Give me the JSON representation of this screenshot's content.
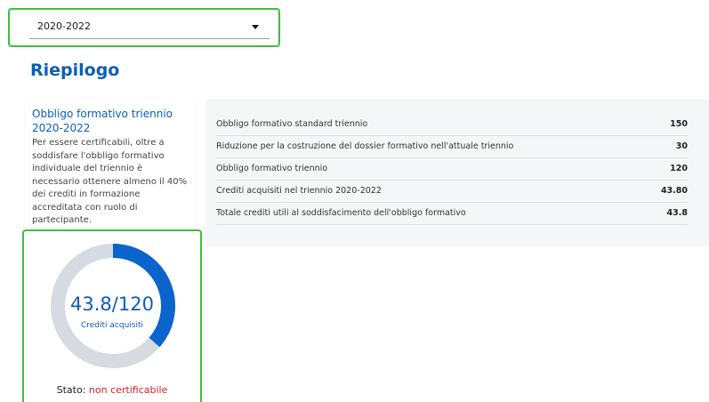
{
  "selector": {
    "value": "2020-2022"
  },
  "section_title": "Riepilogo",
  "info_card": {
    "title": "Obbligo formativo triennio 2020-2022",
    "text": "Per essere certificabili, oltre a soddisfare l'obbligo formativo individuale del triennio è necessario ottenere almeno il 40% dei crediti in formazione accreditata con ruolo di partecipante."
  },
  "progress": {
    "value_text": "43.8/120",
    "label": "Crediti acquisiti",
    "acquired": 43.8,
    "total": 120,
    "progress_color": "#0b64cc",
    "track_color": "#d5dbe0"
  },
  "status": {
    "label": "Stato:",
    "value": "non certificabile",
    "value_color": "#d21f2a"
  },
  "summary": {
    "rows": [
      {
        "label": "Obbligo formativo standard triennio",
        "value": "150"
      },
      {
        "label": "Riduzione per la costruzione del dossier formativo nell'attuale triennio",
        "value": "30"
      },
      {
        "label": "Obbligo formativo triennio",
        "value": "120"
      },
      {
        "label": "Crediti acquisiti nel triennio 2020-2022",
        "value": "43.80"
      },
      {
        "label": "Totale crediti utili al soddisfacimento dell'obbligo formativo",
        "value": "43.8"
      }
    ]
  },
  "icons": {
    "dropdown": "chevron-down-icon"
  }
}
